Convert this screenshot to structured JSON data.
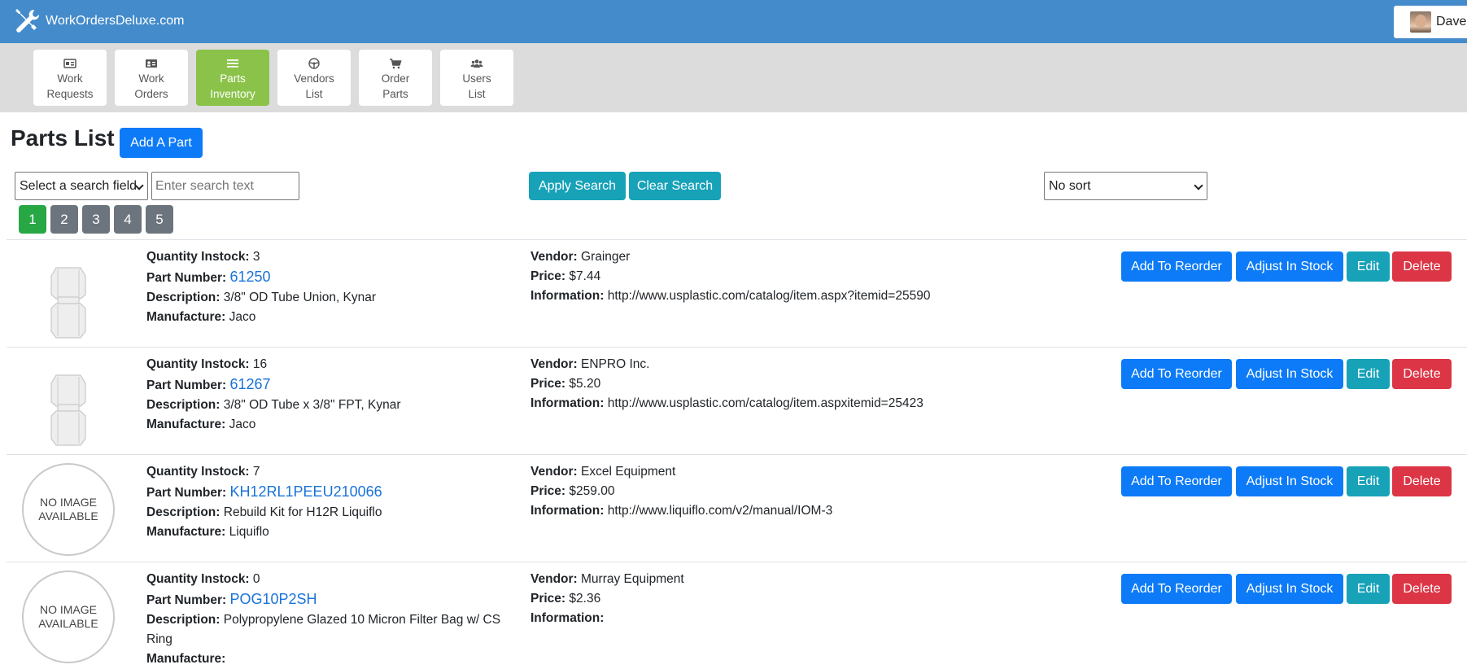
{
  "app": {
    "title": "WorkOrdersDeluxe.com",
    "user_name": "Dave"
  },
  "nav": [
    {
      "line1": "Work",
      "line2": "Requests",
      "icon": "id-card-icon"
    },
    {
      "line1": "Work",
      "line2": "Orders",
      "icon": "id-badge-icon"
    },
    {
      "line1": "Parts",
      "line2": "Inventory",
      "icon": "list-icon",
      "active": true
    },
    {
      "line1": "Vendors",
      "line2": "List",
      "icon": "steering-wheel-icon"
    },
    {
      "line1": "Order",
      "line2": "Parts",
      "icon": "cart-icon"
    },
    {
      "line1": "Users",
      "line2": "List",
      "icon": "users-icon"
    }
  ],
  "page": {
    "title": "Parts List",
    "add_label": "Add A Part"
  },
  "search": {
    "field_select": "Select a search field",
    "placeholder": "Enter search text",
    "apply_label": "Apply Search",
    "clear_label": "Clear Search",
    "sort_select": "No sort"
  },
  "pagination": [
    "1",
    "2",
    "3",
    "4",
    "5"
  ],
  "labels": {
    "quantity": "Quantity Instock:",
    "part_number": "Part Number:",
    "description": "Description:",
    "manufacture": "Manufacture:",
    "vendor": "Vendor:",
    "price": "Price:",
    "information": "Information:",
    "no_image_1": "NO IMAGE",
    "no_image_2": "AVAILABLE"
  },
  "actions": {
    "reorder": "Add To Reorder",
    "adjust": "Adjust In Stock",
    "edit": "Edit",
    "delete": "Delete"
  },
  "parts": [
    {
      "quantity": "3",
      "part_number": "61250",
      "description": "3/8\" OD Tube Union, Kynar",
      "manufacture": "Jaco",
      "vendor": "Grainger",
      "price": "$7.44",
      "information": "http://www.usplastic.com/catalog/item.aspx?itemid=25590",
      "image": "union"
    },
    {
      "quantity": "16",
      "part_number": "61267",
      "description": "3/8\" OD Tube x 3/8\" FPT, Kynar",
      "manufacture": "Jaco",
      "vendor": "ENPRO Inc.",
      "price": "$5.20",
      "information": "http://www.usplastic.com/catalog/item.aspxitemid=25423",
      "image": "union"
    },
    {
      "quantity": "7",
      "part_number": "KH12RL1PEEU210066",
      "description": "Rebuild Kit for H12R Liquiflo",
      "manufacture": "Liquiflo",
      "vendor": "Excel Equipment",
      "price": "$259.00",
      "information": "http://www.liquiflo.com/v2/manual/IOM-3",
      "image": "none"
    },
    {
      "quantity": "0",
      "part_number": "POG10P2SH",
      "description": "Polypropylene Glazed 10 Micron Filter Bag w/ CS Ring",
      "manufacture": "",
      "vendor": "Murray Equipment",
      "price": "$2.36",
      "information": "",
      "image": "none"
    }
  ]
}
